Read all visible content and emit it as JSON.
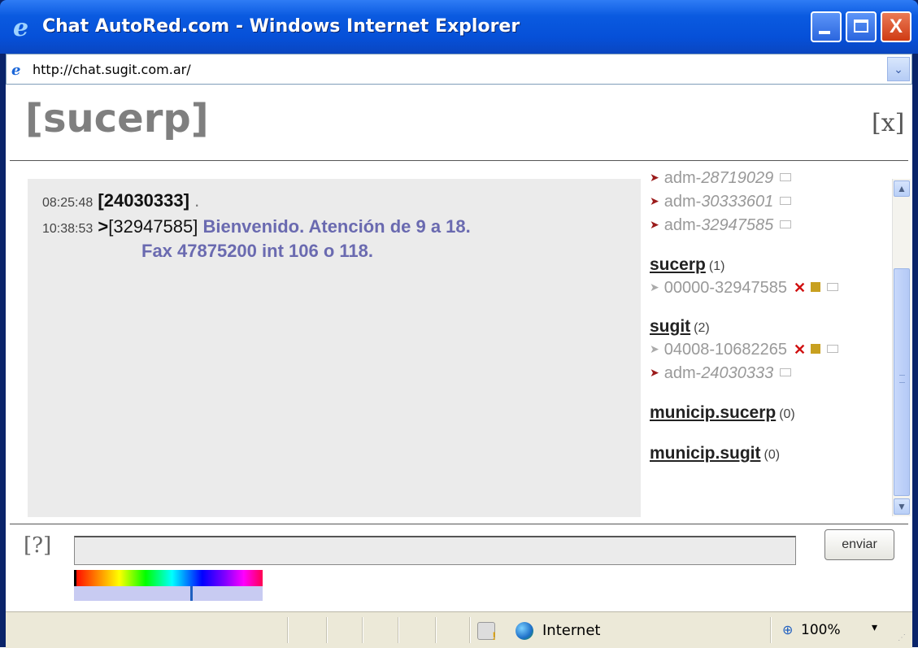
{
  "window": {
    "title": "Chat AutoRed.com - Windows Internet Explorer",
    "minimize_glyph": "",
    "close_glyph": "X"
  },
  "address_bar": {
    "url": "http://chat.sugit.com.ar/",
    "dropdown_glyph": "⌄"
  },
  "room": {
    "title": "[sucerp]",
    "close_label": "[x]"
  },
  "messages": [
    {
      "time": "08:25:48",
      "user": "[24030333]",
      "suffix": "."
    },
    {
      "time": "10:38:53",
      "prefix": ">",
      "user": "[32947585]",
      "text": "Bienvenido. Atención de 9 a 18.",
      "continuation": "Fax 47875200 int 106 o 118."
    }
  ],
  "users_top": [
    {
      "name_prefix": "adm-",
      "name_id": "28719029",
      "arrow": "red"
    },
    {
      "name_prefix": "adm-",
      "name_id": "30333601",
      "arrow": "red"
    },
    {
      "name_prefix": "adm-",
      "name_id": "32947585",
      "arrow": "red"
    }
  ],
  "groups": [
    {
      "name": "sucerp",
      "count": "(1)",
      "members": [
        {
          "name": "00000-32947585",
          "arrow": "grey",
          "actions": true
        }
      ]
    },
    {
      "name": "sugit",
      "count": "(2)",
      "members": [
        {
          "name": "04008-10682265",
          "arrow": "grey",
          "actions": true
        },
        {
          "name_prefix": "adm-",
          "name_id": "24030333",
          "arrow": "red",
          "actions": false
        }
      ]
    },
    {
      "name": "municip.sucerp",
      "count": "(0)"
    },
    {
      "name": "municip.sugit",
      "count": "(0)"
    }
  ],
  "input": {
    "help_label": "[?]",
    "send_label": "enviar",
    "value": ""
  },
  "status_bar": {
    "zone_label": "Internet",
    "zoom_label": "100%",
    "zoom_dropdown": "▾"
  },
  "colors": {
    "title_bar": "#0a5ae0",
    "message_text": "#6a6ab0",
    "chat_bg": "#ebebeb"
  }
}
